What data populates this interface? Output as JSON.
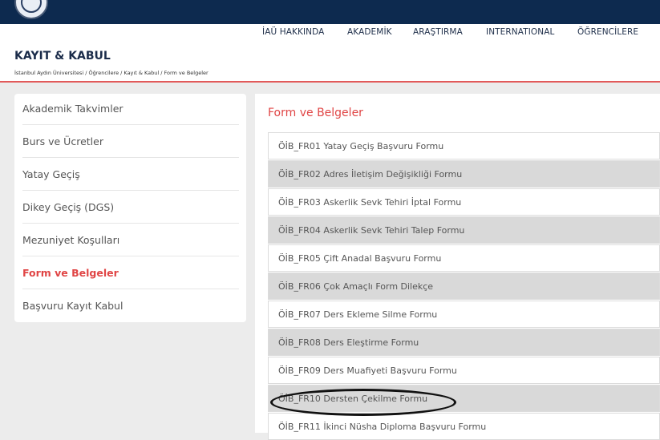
{
  "nav": {
    "items": [
      "İAÜ HAKKINDA",
      "AKADEMİK",
      "ARAŞTIRMA",
      "INTERNATIONAL",
      "ÖĞRENCİLERE"
    ]
  },
  "header": {
    "title": "KAYIT & KABUL",
    "breadcrumb": "İstanbul Aydın Üniversitesi / Öğrencilere / Kayıt & Kabul / Form ve Belgeler"
  },
  "sidebar": {
    "items": [
      {
        "label": "Akademik Takvimler"
      },
      {
        "label": "Burs ve Ücretler"
      },
      {
        "label": "Yatay Geçiş"
      },
      {
        "label": "Dikey Geçiş (DGS)"
      },
      {
        "label": "Mezuniyet Koşulları"
      },
      {
        "label": "Form ve Belgeler",
        "active": true
      },
      {
        "label": "Başvuru Kayıt Kabul"
      }
    ]
  },
  "content": {
    "title": "Form ve Belgeler",
    "forms": [
      "ÖİB_FR01 Yatay Geçiş Başvuru Formu",
      "ÖİB_FR02 Adres İletişim Değişikliği Formu",
      "ÖİB_FR03 Askerlik Sevk Tehiri İptal Formu",
      "ÖİB_FR04 Askerlik Sevk Tehiri Talep Formu",
      "ÖİB_FR05 Çift Anadal Başvuru Formu",
      "ÖİB_FR06 Çok Amaçlı Form Dilekçe",
      "ÖİB_FR07 Ders Ekleme Silme Formu",
      "ÖİB_FR08 Ders Eleştirme Formu",
      "ÖİB_FR09 Ders Muafiyeti Başvuru Formu",
      "ÖİB_FR10 Dersten Çekilme Formu",
      "ÖİB_FR11 İkinci Nüsha Diploma Başvuru Formu"
    ]
  },
  "colors": {
    "topbar": "#0d2a4f",
    "accent": "#e04545",
    "row_gray": "#d9d9d9"
  }
}
